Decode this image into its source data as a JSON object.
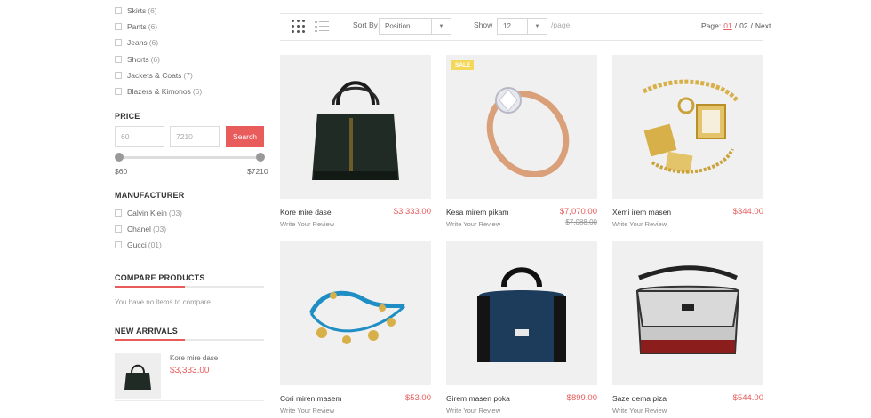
{
  "categories": [
    {
      "label": "Skirts",
      "count": "(6)"
    },
    {
      "label": "Pants",
      "count": "(6)"
    },
    {
      "label": "Jeans",
      "count": "(6)"
    },
    {
      "label": "Shorts",
      "count": "(6)"
    },
    {
      "label": "Jackets & Coats",
      "count": "(7)"
    },
    {
      "label": "Blazers & Kimonos",
      "count": "(6)"
    }
  ],
  "price": {
    "title": "PRICE",
    "min_value": "60",
    "max_value": "7210",
    "search_label": "Search",
    "range_min_label": "$60",
    "range_max_label": "$7210"
  },
  "manufacturer": {
    "title": "MANUFACTURER",
    "items": [
      {
        "label": "Calvin Klein",
        "count": "(03)"
      },
      {
        "label": "Chanel",
        "count": "(03)"
      },
      {
        "label": "Gucci",
        "count": "(01)"
      }
    ]
  },
  "compare": {
    "title": "COMPARE PRODUCTS",
    "note": "You have no items to compare."
  },
  "new_arrivals": {
    "title": "NEW ARRIVALS",
    "items": [
      {
        "name": "Kore mire dase",
        "price": "$3,333.00",
        "icon": "handbag-icon"
      }
    ]
  },
  "toolbar": {
    "sort_label": "Sort By",
    "sort_value": "Position",
    "show_label": "Show",
    "show_value": "12",
    "per_page": "/page",
    "page_label": "Page:",
    "current_page": "01",
    "separator": "/",
    "total_pages": "02",
    "next_label": "Next"
  },
  "products": [
    {
      "name": "Kore mire dase",
      "price": "$3,333.00",
      "old_price": "",
      "review": "Write Your Review",
      "badge": "",
      "icon": "handbag-icon"
    },
    {
      "name": "Kesa mirem pikam",
      "price": "$7,070.00",
      "old_price": "$7,088.00",
      "review": "Write Your Review",
      "badge": "SALE",
      "icon": "ring-icon"
    },
    {
      "name": "Xemi irem masen",
      "price": "$344.00",
      "old_price": "",
      "review": "Write Your Review",
      "badge": "",
      "icon": "watch-jewelry-icon"
    },
    {
      "name": "Cori miren masem",
      "price": "$53.00",
      "old_price": "",
      "review": "Write Your Review",
      "badge": "",
      "icon": "bracelet-icon"
    },
    {
      "name": "Girem masen poka",
      "price": "$899.00",
      "old_price": "",
      "review": "Write Your Review",
      "badge": "",
      "icon": "duffel-bag-icon"
    },
    {
      "name": "Saze dema piza",
      "price": "$544.00",
      "old_price": "",
      "review": "Write Your Review",
      "badge": "",
      "icon": "messenger-bag-icon"
    }
  ],
  "colors": {
    "accent": "#e95c5c",
    "sale_badge": "#f3d85a"
  }
}
